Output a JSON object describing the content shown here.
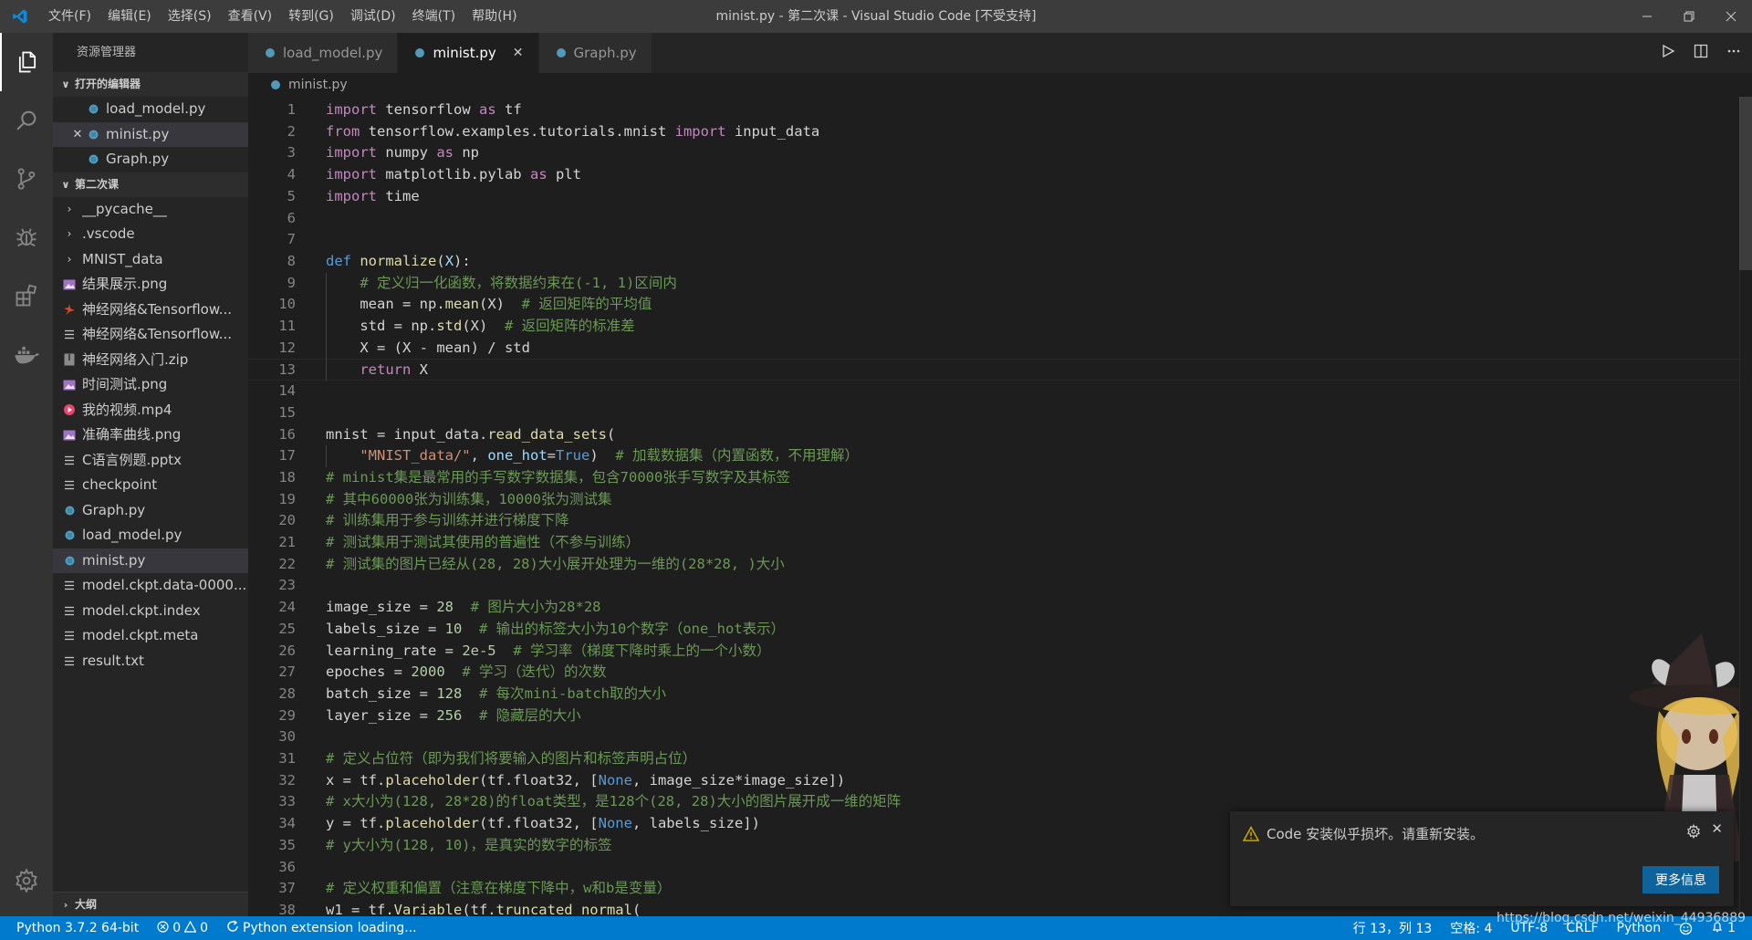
{
  "titlebar": {
    "menu": [
      "文件(F)",
      "编辑(E)",
      "选择(S)",
      "查看(V)",
      "转到(G)",
      "调试(D)",
      "终端(T)",
      "帮助(H)"
    ],
    "title": "minist.py - 第二次课 - Visual Studio Code [不受支持]"
  },
  "sidebar": {
    "title": "资源管理器",
    "open_editors_label": "打开的编辑器",
    "open_editors": [
      "load_model.py",
      "minist.py",
      "Graph.py"
    ],
    "folder_label": "第二次课",
    "folders": [
      "__pycache__",
      ".vscode",
      "MNIST_data"
    ],
    "files": [
      {
        "name": "结果展示.png",
        "icon": "image-icon"
      },
      {
        "name": "神经网络&Tensorflow...",
        "icon": "pdf-icon"
      },
      {
        "name": "神经网络&Tensorflow...",
        "icon": "file-lines-icon"
      },
      {
        "name": "神经网络入门.zip",
        "icon": "zip-icon"
      },
      {
        "name": "时间测试.png",
        "icon": "image-icon"
      },
      {
        "name": "我的视频.mp4",
        "icon": "video-icon"
      },
      {
        "name": "准确率曲线.png",
        "icon": "image-icon"
      },
      {
        "name": "C语言例题.pptx",
        "icon": "file-lines-icon"
      },
      {
        "name": "checkpoint",
        "icon": "file-lines-icon"
      },
      {
        "name": "Graph.py",
        "icon": "python-icon"
      },
      {
        "name": "load_model.py",
        "icon": "python-icon"
      },
      {
        "name": "minist.py",
        "icon": "python-icon"
      },
      {
        "name": "model.ckpt.data-0000...",
        "icon": "file-lines-icon"
      },
      {
        "name": "model.ckpt.index",
        "icon": "file-lines-icon"
      },
      {
        "name": "model.ckpt.meta",
        "icon": "file-lines-icon"
      },
      {
        "name": "result.txt",
        "icon": "file-lines-icon"
      }
    ],
    "outline_label": "大纲"
  },
  "tabs": [
    "load_model.py",
    "minist.py",
    "Graph.py"
  ],
  "breadcrumb": "minist.py",
  "editor": {
    "current_line": 13,
    "lines": [
      {
        "n": "1",
        "t": [
          [
            "c",
            "import"
          ],
          [
            "t",
            " tensorflow "
          ],
          [
            "c",
            "as"
          ],
          [
            "t",
            " tf"
          ]
        ]
      },
      {
        "n": "2",
        "t": [
          [
            "c",
            "from"
          ],
          [
            "t",
            " tensorflow.examples.tutorials.mnist "
          ],
          [
            "c",
            "import"
          ],
          [
            "t",
            " input_data"
          ]
        ]
      },
      {
        "n": "3",
        "t": [
          [
            "c",
            "import"
          ],
          [
            "t",
            " numpy "
          ],
          [
            "c",
            "as"
          ],
          [
            "t",
            " np"
          ]
        ]
      },
      {
        "n": "4",
        "t": [
          [
            "c",
            "import"
          ],
          [
            "t",
            " matplotlib.pylab "
          ],
          [
            "c",
            "as"
          ],
          [
            "t",
            " plt"
          ]
        ]
      },
      {
        "n": "5",
        "t": [
          [
            "c",
            "import"
          ],
          [
            "t",
            " time"
          ]
        ]
      },
      {
        "n": "6",
        "t": []
      },
      {
        "n": "7",
        "t": []
      },
      {
        "n": "8",
        "t": [
          [
            "k",
            "def"
          ],
          [
            "t",
            " "
          ],
          [
            "f",
            "normalize"
          ],
          [
            "t",
            "("
          ],
          [
            "p",
            "X"
          ],
          [
            "t",
            "):"
          ]
        ]
      },
      {
        "n": "9",
        "t": [
          [
            "t",
            "    "
          ],
          [
            "cm",
            "# 定义归一化函数，将数据约束在(-1, 1)区间内"
          ]
        ]
      },
      {
        "n": "10",
        "t": [
          [
            "t",
            "    mean = np."
          ],
          [
            "f",
            "mean"
          ],
          [
            "t",
            "(X)  "
          ],
          [
            "cm",
            "# 返回矩阵的平均值"
          ]
        ]
      },
      {
        "n": "11",
        "t": [
          [
            "t",
            "    std = np."
          ],
          [
            "f",
            "std"
          ],
          [
            "t",
            "(X)  "
          ],
          [
            "cm",
            "# 返回矩阵的标准差"
          ]
        ]
      },
      {
        "n": "12",
        "t": [
          [
            "t",
            "    X = (X - mean) / std"
          ]
        ]
      },
      {
        "n": "13",
        "t": [
          [
            "t",
            "    "
          ],
          [
            "c",
            "return"
          ],
          [
            "t",
            " X"
          ]
        ]
      },
      {
        "n": "14",
        "t": []
      },
      {
        "n": "15",
        "t": []
      },
      {
        "n": "16",
        "t": [
          [
            "t",
            "mnist = input_data."
          ],
          [
            "f",
            "read_data_sets"
          ],
          [
            "t",
            "("
          ]
        ]
      },
      {
        "n": "17",
        "t": [
          [
            "t",
            "    "
          ],
          [
            "s",
            "\"MNIST_data/\""
          ],
          [
            "t",
            ", "
          ],
          [
            "p",
            "one_hot"
          ],
          [
            "t",
            "="
          ],
          [
            "k",
            "True"
          ],
          [
            "t",
            ")  "
          ],
          [
            "cm",
            "# 加载数据集（内置函数，不用理解）"
          ]
        ]
      },
      {
        "n": "18",
        "t": [
          [
            "cm",
            "# minist集是最常用的手写数字数据集，包含70000张手写数字及其标签"
          ]
        ]
      },
      {
        "n": "19",
        "t": [
          [
            "cm",
            "# 其中60000张为训练集，10000张为测试集"
          ]
        ]
      },
      {
        "n": "20",
        "t": [
          [
            "cm",
            "# 训练集用于参与训练并进行梯度下降"
          ]
        ]
      },
      {
        "n": "21",
        "t": [
          [
            "cm",
            "# 测试集用于测试其使用的普遍性（不参与训练）"
          ]
        ]
      },
      {
        "n": "22",
        "t": [
          [
            "cm",
            "# 测试集的图片已经从(28, 28)大小展开处理为一维的(28*28, )大小"
          ]
        ]
      },
      {
        "n": "23",
        "t": []
      },
      {
        "n": "24",
        "t": [
          [
            "t",
            "image_size = "
          ],
          [
            "n",
            "28"
          ],
          [
            "t",
            "  "
          ],
          [
            "cm",
            "# 图片大小为28*28"
          ]
        ]
      },
      {
        "n": "25",
        "t": [
          [
            "t",
            "labels_size = "
          ],
          [
            "n",
            "10"
          ],
          [
            "t",
            "  "
          ],
          [
            "cm",
            "# 输出的标签大小为10个数字（one_hot表示）"
          ]
        ]
      },
      {
        "n": "26",
        "t": [
          [
            "t",
            "learning_rate = "
          ],
          [
            "n",
            "2e-5"
          ],
          [
            "t",
            "  "
          ],
          [
            "cm",
            "# 学习率（梯度下降时乘上的一个小数）"
          ]
        ]
      },
      {
        "n": "27",
        "t": [
          [
            "t",
            "epoches = "
          ],
          [
            "n",
            "2000"
          ],
          [
            "t",
            "  "
          ],
          [
            "cm",
            "# 学习（迭代）的次数"
          ]
        ]
      },
      {
        "n": "28",
        "t": [
          [
            "t",
            "batch_size = "
          ],
          [
            "n",
            "128"
          ],
          [
            "t",
            "  "
          ],
          [
            "cm",
            "# 每次mini-batch取的大小"
          ]
        ]
      },
      {
        "n": "29",
        "t": [
          [
            "t",
            "layer_size = "
          ],
          [
            "n",
            "256"
          ],
          [
            "t",
            "  "
          ],
          [
            "cm",
            "# 隐藏层的大小"
          ]
        ]
      },
      {
        "n": "30",
        "t": []
      },
      {
        "n": "31",
        "t": [
          [
            "cm",
            "# 定义占位符（即为我们将要输入的图片和标签声明占位）"
          ]
        ]
      },
      {
        "n": "32",
        "t": [
          [
            "t",
            "x = tf."
          ],
          [
            "f",
            "placeholder"
          ],
          [
            "t",
            "(tf.float32, ["
          ],
          [
            "k",
            "None"
          ],
          [
            "t",
            ", image_size*image_size])"
          ]
        ]
      },
      {
        "n": "33",
        "t": [
          [
            "cm",
            "# x大小为(128, 28*28)的float类型，是128个(28, 28)大小的图片展开成一维的矩阵"
          ]
        ]
      },
      {
        "n": "34",
        "t": [
          [
            "t",
            "y = tf."
          ],
          [
            "f",
            "placeholder"
          ],
          [
            "t",
            "(tf.float32, ["
          ],
          [
            "k",
            "None"
          ],
          [
            "t",
            ", labels_size])"
          ]
        ]
      },
      {
        "n": "35",
        "t": [
          [
            "cm",
            "# y大小为(128, 10)，是真实的数字的标签"
          ]
        ]
      },
      {
        "n": "36",
        "t": []
      },
      {
        "n": "37",
        "t": [
          [
            "cm",
            "# 定义权重和偏置（注意在梯度下降中，w和b是变量）"
          ]
        ]
      },
      {
        "n": "38",
        "t": [
          [
            "t",
            "w1 = tf."
          ],
          [
            "f",
            "Variable"
          ],
          [
            "t",
            "(tf."
          ],
          [
            "f",
            "truncated_normal"
          ],
          [
            "t",
            "("
          ]
        ]
      }
    ]
  },
  "notification": {
    "message": "Code 安装似乎损坏。请重新安装。",
    "button": "更多信息"
  },
  "statusbar": {
    "python": "Python 3.7.2 64-bit",
    "errors": "0",
    "warnings": "0",
    "loading": "Python extension loading...",
    "position": "行 13，列 13",
    "spaces": "空格: 4",
    "encoding": "UTF-8",
    "eol": "CRLF",
    "language": "Python",
    "notifications": "1"
  },
  "watermark": "https://blog.csdn.net/weixin_44936889",
  "colors": {
    "accent": "#007acc",
    "keyword": "#569cd6",
    "control": "#c586c0",
    "function": "#dcdcaa",
    "comment": "#6a9955",
    "number": "#b5cea8",
    "string": "#ce9178",
    "python_icon": "#519aba"
  }
}
